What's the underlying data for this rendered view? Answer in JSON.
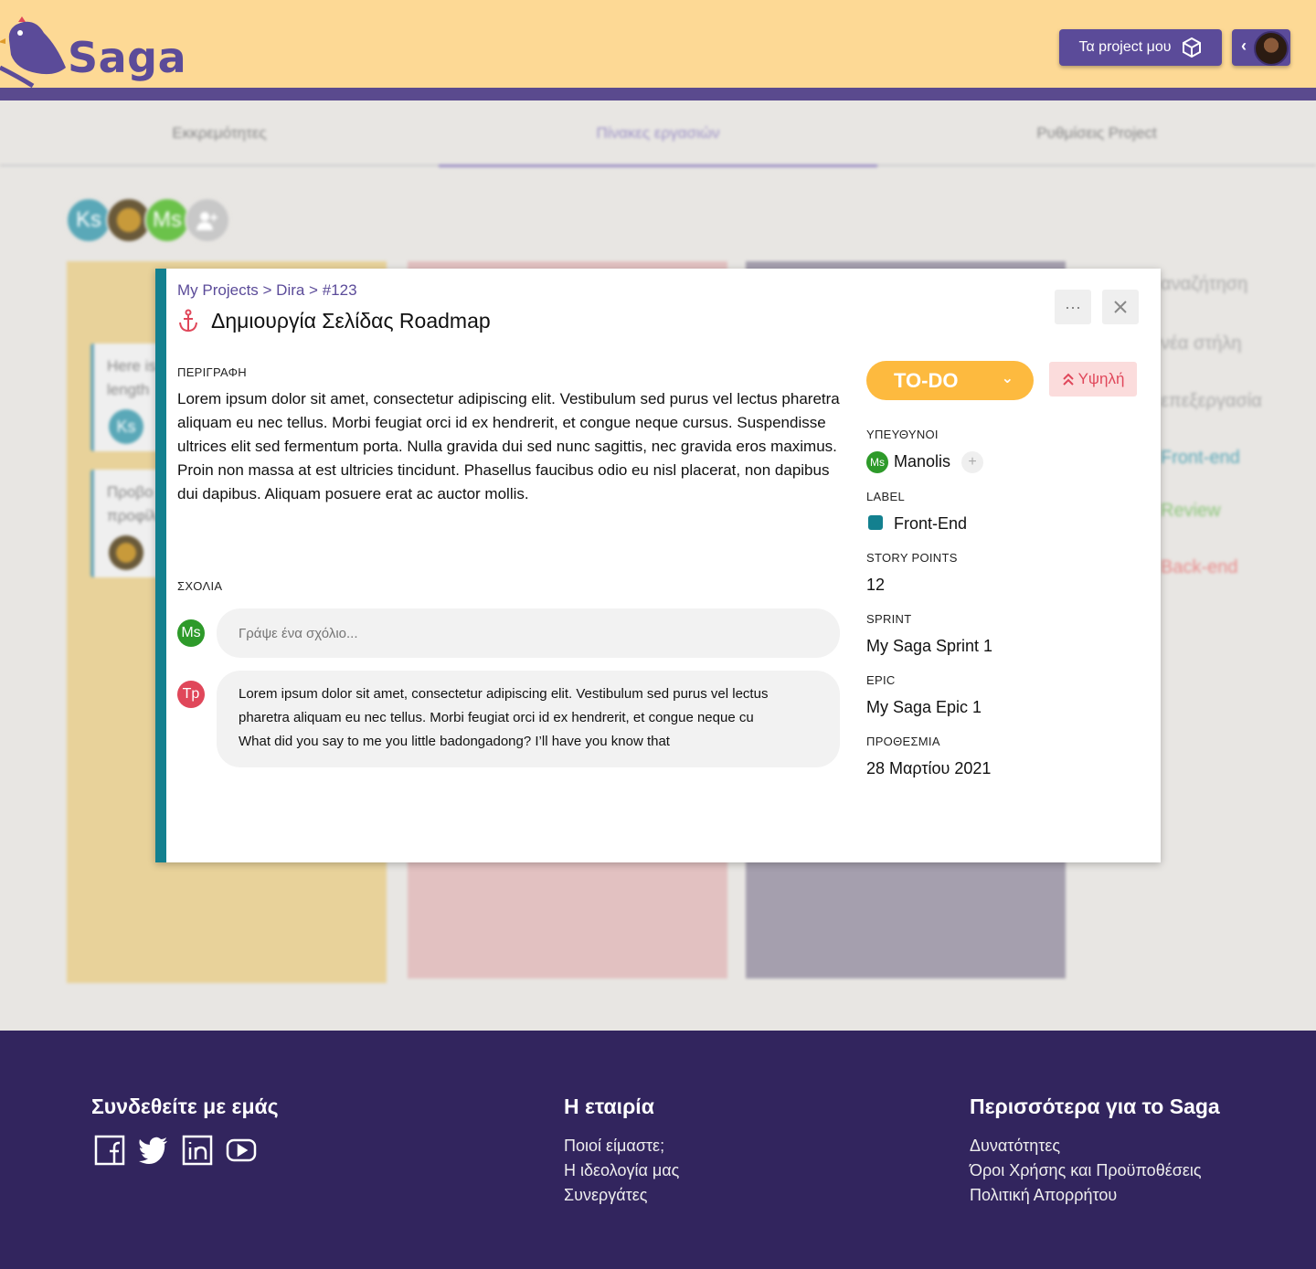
{
  "header": {
    "logo_text": "Saga",
    "projects_button": "Τα project μου"
  },
  "tabs": [
    "Εκκρεμότητες",
    "Πίνακες εργασιών",
    "Ρυθμίσεις Project"
  ],
  "members": [
    "Ks",
    "",
    "Ms",
    ""
  ],
  "background": {
    "card1_text": [
      "Here is",
      "length"
    ],
    "card1_avatar": "Ks",
    "card2_text": [
      "Προβο",
      "προφίλ"
    ],
    "side_links": [
      "αναζήτηση",
      "νέα στήλη",
      "επεξεργασία",
      "Front-end",
      "Review",
      "Back-end"
    ]
  },
  "task": {
    "breadcrumb": "My Projects > Dira > #123",
    "title": "Δημιουργία Σελίδας Roadmap",
    "more_icon": "more-dots-icon",
    "close_icon": "close-icon",
    "description_label": "ΠΕΡΙΓΡΑΦΗ",
    "description": "Lorem ipsum dolor sit amet, consectetur adipiscing elit. Vestibulum sed purus vel lectus pharetra aliquam eu nec tellus. Morbi feugiat orci id ex hendrerit, et congue neque cursus. Suspendisse ultrices elit sed fermentum porta. Nulla gravida dui sed nunc sagittis, nec gravida eros maximus. Proin non massa at est ultricies tincidunt. Phasellus faucibus odio eu nisl placerat, non dapibus dui dapibus. Aliquam posuere erat ac auctor mollis.",
    "comments_label": "ΣΧΟΛΙΑ",
    "comment_input": {
      "avatar": "Ms",
      "placeholder": "Γράψε ένα σχόλιο..."
    },
    "comments": [
      {
        "avatar": "Tp",
        "lines": [
          "Lorem ipsum dolor sit amet, consectetur adipiscing elit. Vestibulum sed purus vel lectus",
          "pharetra aliquam eu nec tellus. Morbi feugiat orci id ex hendrerit, et congue neque cu",
          "What did you say to me you little badongadong? I’ll have you know that"
        ]
      }
    ],
    "status": "TO-DO",
    "priority": "Υψηλή",
    "assignees_label": "ΥΠΕΥΘΥΝΟΙ",
    "assignee_avatar": "Ms",
    "assignee_name": "Manolis",
    "label_label": "LABEL",
    "label_value": "Front-End",
    "story_points_label": "STORY POINTS",
    "story_points": "12",
    "sprint_label": "SPRINT",
    "sprint": "My Saga Sprint 1",
    "epic_label": "EPIC",
    "epic": "My Saga Epic 1",
    "deadline_label": "ΠΡΟΘΕΣΜΙΑ",
    "deadline": "28 Μαρτίου 2021"
  },
  "colors": {
    "brand_purple": "#5b4b99",
    "header_yellow": "#fdd995",
    "stripe_teal": "#13808f",
    "status_orange": "#fdba3f",
    "priority_red": "#e0475a",
    "footer_bg": "#32255e"
  },
  "footer": {
    "connect_heading": "Συνδεθείτε με εμάς",
    "social_icons": [
      "facebook-icon",
      "twitter-icon",
      "linkedin-icon",
      "youtube-icon"
    ],
    "company_heading": "Η εταιρία",
    "company_links": [
      "Ποιοί είμαστε;",
      "Η ιδεολογία μας",
      "Συνεργάτες"
    ],
    "more_heading": "Περισσότερα για το Saga",
    "more_links": [
      "Δυνατότητες",
      "Όροι Χρήσης και Προϋποθέσεις",
      "Πολιτική Απορρήτου"
    ]
  }
}
